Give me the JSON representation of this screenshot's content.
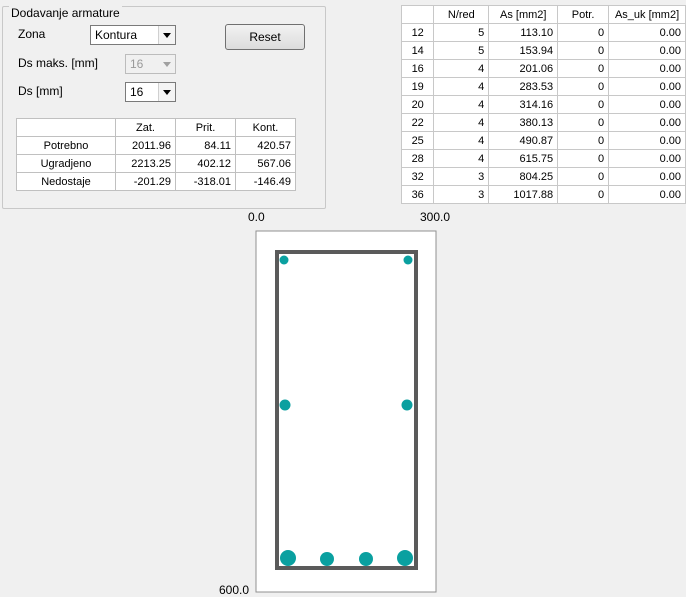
{
  "panel": {
    "title": "Dodavanje armature",
    "zona_label": "Zona",
    "zona_value": "Kontura",
    "ds_maks_label": "Ds maks. [mm]",
    "ds_maks_value": "16",
    "ds_label": "Ds [mm]",
    "ds_value": "16",
    "reset_label": "Reset"
  },
  "summary_table": {
    "headers": [
      "",
      "Zat.",
      "Prit.",
      "Kont."
    ],
    "rows": [
      {
        "label": "Potrebno",
        "values": [
          "2011.96",
          "84.11",
          "420.57"
        ]
      },
      {
        "label": "Ugradjeno",
        "values": [
          "2213.25",
          "402.12",
          "567.06"
        ]
      },
      {
        "label": "Nedostaje",
        "values": [
          "-201.29",
          "-318.01",
          "-146.49"
        ]
      }
    ]
  },
  "bar_table": {
    "headers": [
      "",
      "N/red",
      "As [mm2]",
      "Potr.",
      "As_uk [mm2]"
    ],
    "rows": [
      {
        "ds": "12",
        "n": "5",
        "as": "113.10",
        "potr": "0",
        "as_uk": "0.00"
      },
      {
        "ds": "14",
        "n": "5",
        "as": "153.94",
        "potr": "0",
        "as_uk": "0.00"
      },
      {
        "ds": "16",
        "n": "4",
        "as": "201.06",
        "potr": "0",
        "as_uk": "0.00"
      },
      {
        "ds": "19",
        "n": "4",
        "as": "283.53",
        "potr": "0",
        "as_uk": "0.00"
      },
      {
        "ds": "20",
        "n": "4",
        "as": "314.16",
        "potr": "0",
        "as_uk": "0.00"
      },
      {
        "ds": "22",
        "n": "4",
        "as": "380.13",
        "potr": "0",
        "as_uk": "0.00"
      },
      {
        "ds": "25",
        "n": "4",
        "as": "490.87",
        "potr": "0",
        "as_uk": "0.00"
      },
      {
        "ds": "28",
        "n": "4",
        "as": "615.75",
        "potr": "0",
        "as_uk": "0.00"
      },
      {
        "ds": "32",
        "n": "3",
        "as": "804.25",
        "potr": "0",
        "as_uk": "0.00"
      },
      {
        "ds": "36",
        "n": "3",
        "as": "1017.88",
        "potr": "0",
        "as_uk": "0.00"
      }
    ]
  },
  "section": {
    "x_min_label": "0.0",
    "x_max_label": "300.0",
    "y_max_label": "600.0",
    "bar_color": "#0aa0a0",
    "stirrup_color": "#5a5a5a"
  }
}
